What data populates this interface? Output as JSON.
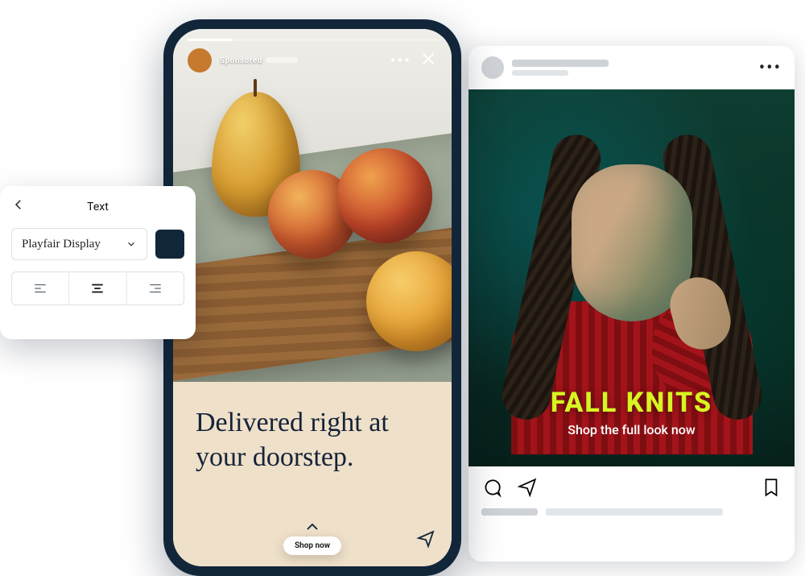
{
  "text_panel": {
    "title": "Text",
    "font_name": "Playfair Display",
    "color": "#12263a",
    "alignment": "center"
  },
  "story": {
    "sponsored_label": "Sponsored",
    "headline": "Delivered right at your doorstep.",
    "cta_label": "Shop now"
  },
  "feed": {
    "overlay_title": "FALL KNITS",
    "overlay_tagline": "Shop the full look now"
  },
  "icons": {
    "back": "chevron-left",
    "dropdown": "chevron-down",
    "more": "•••",
    "close": "x",
    "comment": "speech-bubble",
    "share": "paper-plane",
    "save": "bookmark",
    "chevron_up": "chevron-up"
  }
}
